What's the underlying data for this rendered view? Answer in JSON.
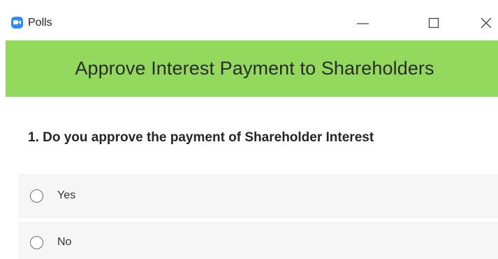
{
  "window": {
    "title": "Polls",
    "app_icon": "zoom-camera-icon",
    "controls": {
      "minimize_icon": "minimize-icon",
      "maximize_icon": "maximize-icon",
      "close_icon": "close-icon"
    }
  },
  "poll": {
    "title": "Approve Interest Payment to Shareholders",
    "header_color": "#92d95e",
    "question": {
      "text": "1. Do you approve the payment of Shareholder Interest",
      "options": [
        {
          "label": "Yes",
          "selected": false
        },
        {
          "label": "No",
          "selected": false
        }
      ]
    }
  },
  "colors": {
    "app_icon": "#2d8cff",
    "option_background": "#f6f6f6"
  }
}
